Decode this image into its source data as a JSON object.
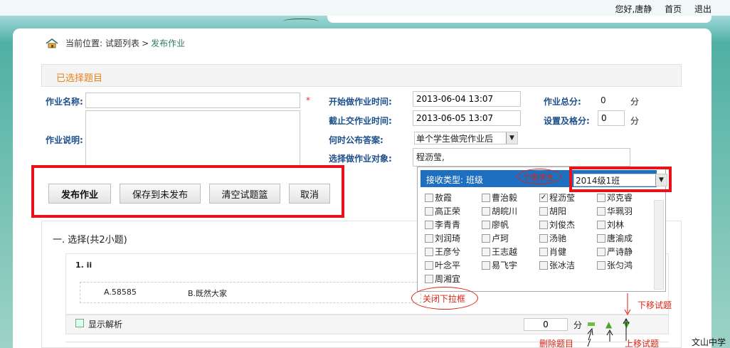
{
  "topnav": {
    "greeting": "您好,唐静",
    "home": "首页",
    "logout": "退出"
  },
  "breadcrumb": {
    "prefix": "当前位置:",
    "parent": "试题列表",
    "sep": ">",
    "current": "发布作业"
  },
  "section_title": "已选择题目",
  "form": {
    "name_label": "作业名称:",
    "name_value": "",
    "required_mark": "*",
    "desc_label": "作业说明:",
    "start_label": "开始做作业时间:",
    "start_value": "2013-06-04 13:07",
    "end_label": "截止交作业时间:",
    "end_value": "2013-06-05 13:07",
    "publish_answer_label": "何时公布答案:",
    "publish_answer_value": "单个学生做完作业后",
    "target_label": "选择做作业对象:",
    "target_value": "程沥莹,",
    "total_label": "作业总分:",
    "total_value": "0",
    "unit": "分",
    "pass_label": "设置及格分:",
    "pass_value": "0"
  },
  "buttons": {
    "publish": "发布作业",
    "save": "保存到未发布",
    "clear": "清空试题篮",
    "cancel": "取消"
  },
  "dropdown": {
    "type_label": "接收类型:",
    "type_value": "班级",
    "annotation": "个别学生",
    "class_value": "2014级1班",
    "students": [
      [
        "敖霞",
        "曹治毅",
        "程沥莹",
        "邓克睿"
      ],
      [
        "高正荣",
        "胡皖川",
        "胡阳",
        "华珮羽"
      ],
      [
        "李青青",
        "廖帆",
        "刘俊杰",
        "刘林"
      ],
      [
        "刘润琦",
        "卢珂",
        "汤驰",
        "唐渝成"
      ],
      [
        "王彦兮",
        "王志越",
        "肖健",
        "严诗静"
      ],
      [
        "叶念平",
        "易飞宇",
        "张冰洁",
        "张匀鸿"
      ],
      [
        "周湘宜"
      ]
    ],
    "checked": "程沥莹"
  },
  "question": {
    "section": "一. 选择(共2小题)",
    "number": "1. ii",
    "option_a": "A.58585",
    "option_b": "B.既然大家",
    "show_analysis": "显示解析",
    "score": "0",
    "unit": "分"
  },
  "annotations": {
    "close_dropdown": "关闭下拉框",
    "move_down": "下移试题",
    "delete": "删除题目",
    "move_up": "上移试题"
  },
  "footer_school": "文山中学"
}
